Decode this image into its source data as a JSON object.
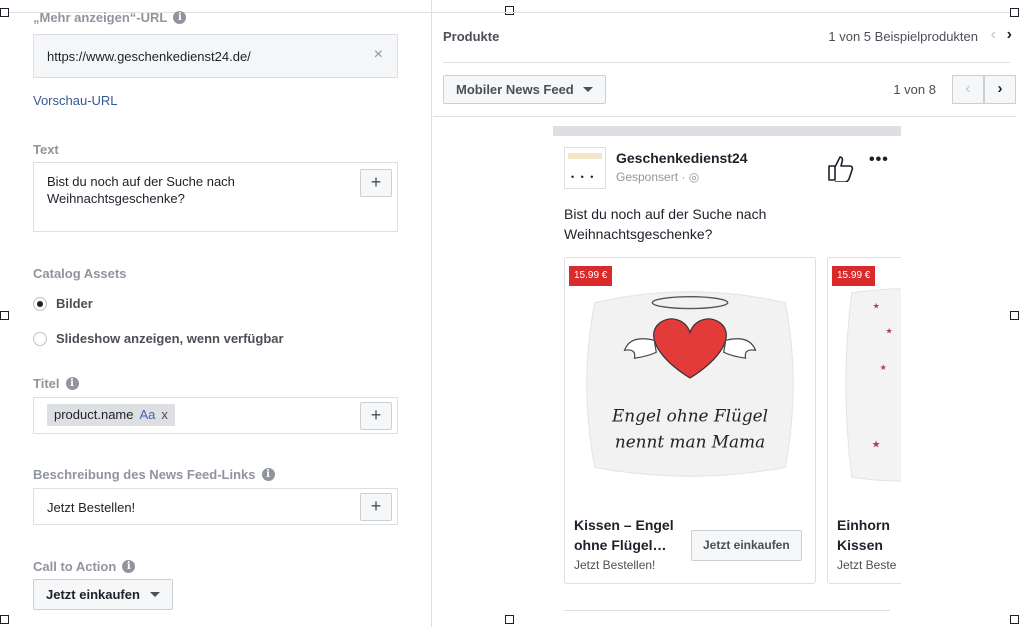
{
  "left": {
    "more_url_label": "„Mehr anzeigen“-URL",
    "url_value": "https://www.geschenkedienst24.de/",
    "preview_url_link": "Vorschau-URL",
    "text_label": "Text",
    "text_value": "Bist du noch auf der Suche nach Weihnachtsgeschenke?",
    "catalog_assets_label": "Catalog Assets",
    "option_images": "Bilder",
    "option_slideshow": "Slideshow anzeigen, wenn verfügbar",
    "selected_option": "Bilder",
    "title_label": "Titel",
    "title_token": "product.name",
    "title_token_suffix": "Aa",
    "newsfeed_desc_label": "Beschreibung des News Feed-Links",
    "newsfeed_desc_value": "Jetzt Bestellen!",
    "cta_label": "Call to Action",
    "cta_value": "Jetzt einkaufen"
  },
  "right": {
    "products_title": "Produkte",
    "sample_count": "1 von 5 Beispielprodukten",
    "placement": "Mobiler News Feed",
    "page_count": "1 von 8",
    "ad": {
      "page_name": "Geschenkedienst24",
      "sponsored": "Gesponsert · ",
      "text": "Bist du noch auf der Suche nach Weihnachtsgeschenke?",
      "cards": [
        {
          "price": "15.99 €",
          "title": "Kissen – Engel ohne Flügel…",
          "desc": "Jetzt Bestellen!",
          "cta": "Jetzt einkaufen",
          "pillow_line1": "Engel ohne Flügel",
          "pillow_line2": "nennt man Mama"
        },
        {
          "price": "15.99 €",
          "title": "Einhorn Kissen",
          "desc": "Jetzt Beste"
        }
      ]
    }
  },
  "colors": {
    "link": "#365899",
    "price_badge": "#d92b2b",
    "border": "#dddfe2"
  }
}
